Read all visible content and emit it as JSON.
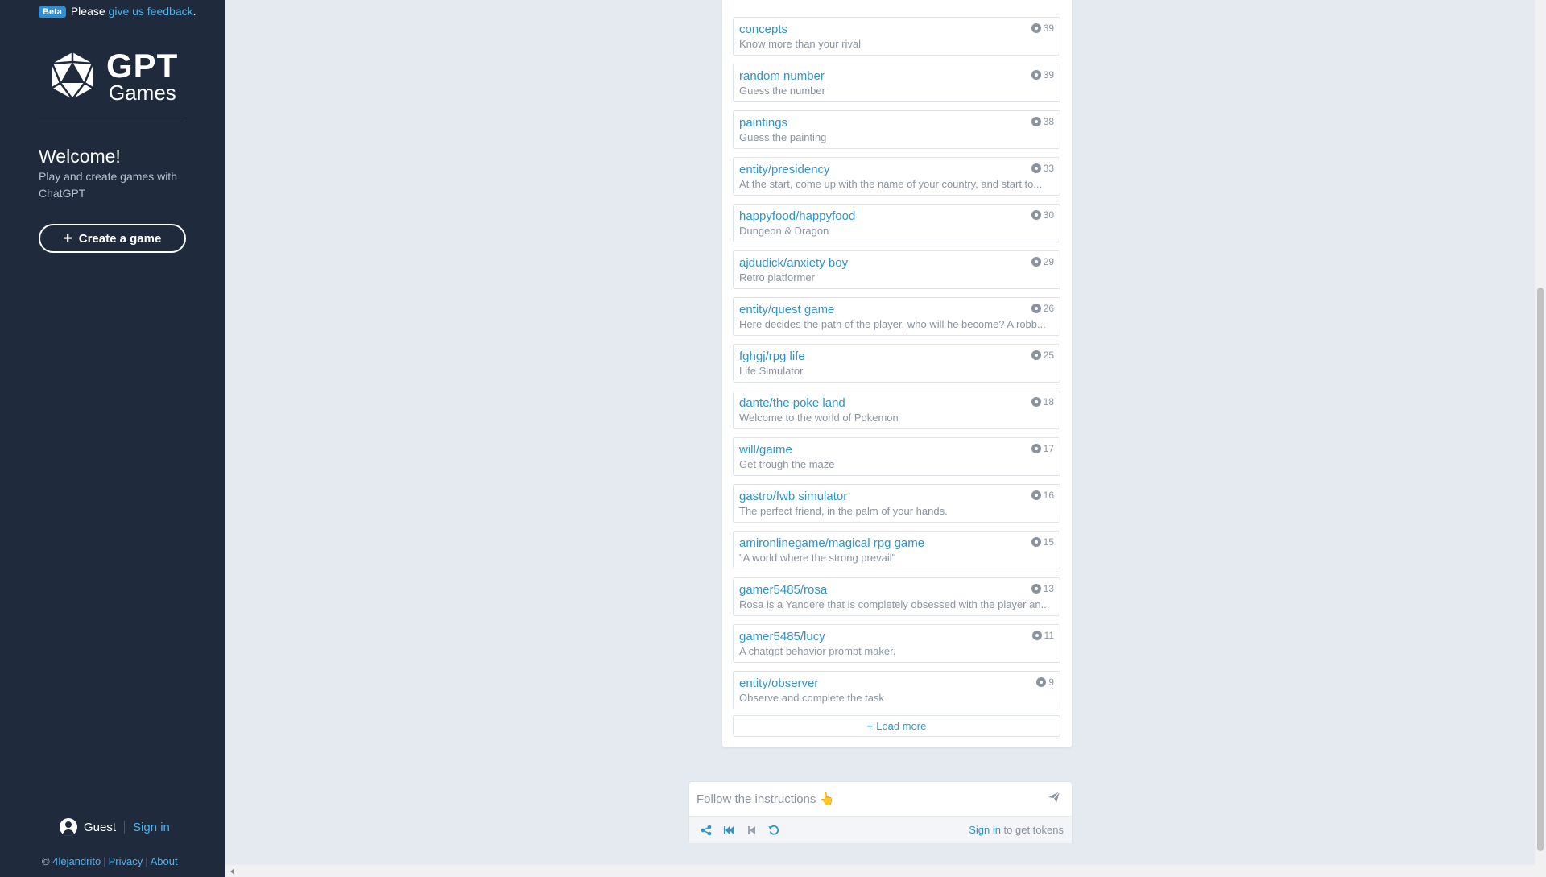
{
  "sidebar": {
    "beta_badge": "Beta",
    "beta_text": "Please",
    "feedback_link": "give us feedback",
    "period": ".",
    "logo_gpt": "GPT",
    "logo_games": "Games",
    "welcome_title": "Welcome!",
    "welcome_text": "Play and create games with ChatGPT",
    "create_button": "Create a game",
    "guest_label": "Guest",
    "sign_in": "Sign in",
    "footer": {
      "copyright": "©",
      "author": "4lejandrito",
      "privacy": "Privacy",
      "about": "About"
    }
  },
  "games": [
    {
      "title": "concepts",
      "description": "Know more than your rival",
      "players": "39"
    },
    {
      "title": "random number",
      "description": "Guess the number",
      "players": "39"
    },
    {
      "title": "paintings",
      "description": "Guess the painting",
      "players": "38"
    },
    {
      "title": "entity/presidency",
      "description": "At the start, come up with the name of your country, and start to...",
      "players": "33"
    },
    {
      "title": "happyfood/happyfood",
      "description": "Dungeon & Dragon",
      "players": "30"
    },
    {
      "title": "ajdudick/anxiety boy",
      "description": "Retro platformer",
      "players": "29"
    },
    {
      "title": "entity/quest game",
      "description": "Here decides the path of the player, who will he become? A robb...",
      "players": "26"
    },
    {
      "title": "fghgj/rpg life",
      "description": "Life Simulator",
      "players": "25"
    },
    {
      "title": "dante/the poke land",
      "description": "Welcome to the world of Pokemon",
      "players": "18"
    },
    {
      "title": "will/gaime",
      "description": "Get trough the maze",
      "players": "17"
    },
    {
      "title": "gastro/fwb simulator",
      "description": "The perfect friend, in the palm of your hands.",
      "players": "16"
    },
    {
      "title": "amironlinegame/magical rpg game",
      "description": "\"A world where the strong prevail\"",
      "players": "15"
    },
    {
      "title": "gamer5485/rosa",
      "description": "Rosa is a Yandere that is completely obsessed with the player an...",
      "players": "13"
    },
    {
      "title": "gamer5485/lucy",
      "description": "A chatgpt behavior prompt maker.",
      "players": "11"
    },
    {
      "title": "entity/observer",
      "description": "Observe and complete the task",
      "players": "9"
    }
  ],
  "load_more": "Load more",
  "chat": {
    "placeholder": "Follow the instructions 👆",
    "sign_in": "Sign in",
    "tokens_text": " to get tokens"
  },
  "colors": {
    "sidebar_bg": "#1f2b3c",
    "link": "#2f93cf",
    "page_bg": "#e5e9f0"
  }
}
